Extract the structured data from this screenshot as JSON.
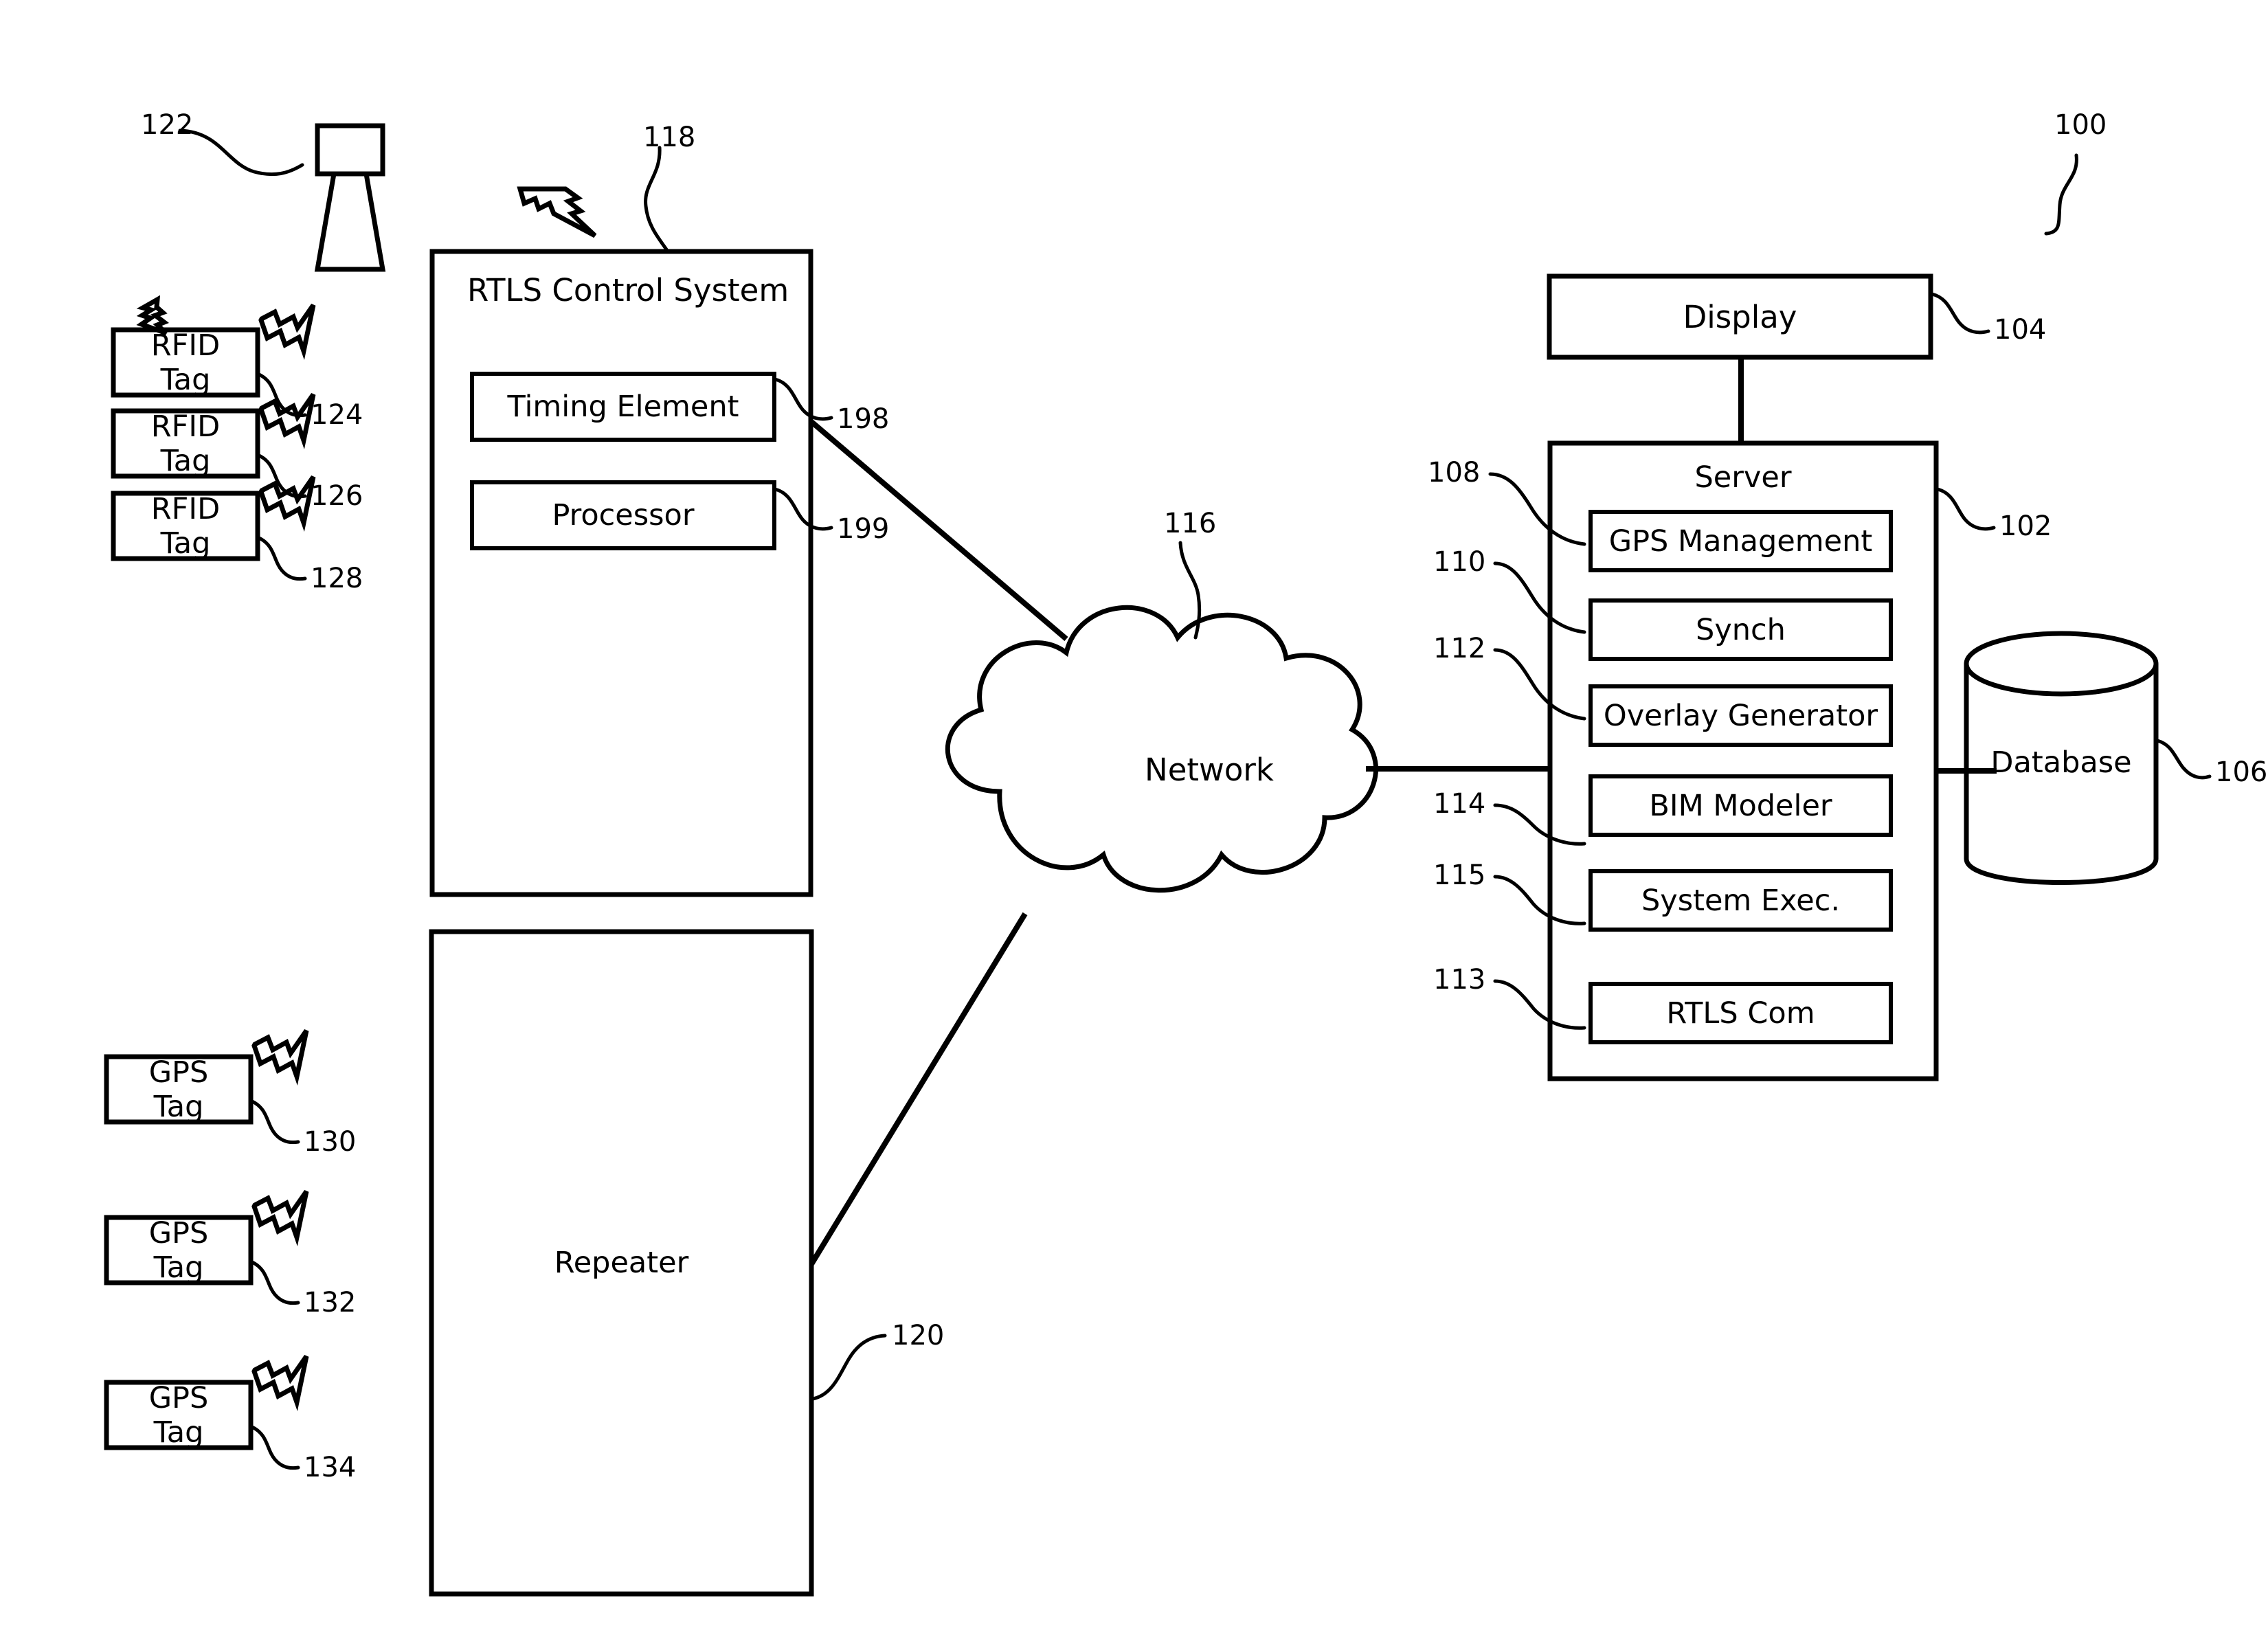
{
  "figure": {
    "system_ref": "100",
    "domain": "patent-block-diagram"
  },
  "antenna": {
    "name": "rtls-antenna",
    "ref": "122"
  },
  "rfid_tags": [
    {
      "line1": "RFID",
      "line2": "Tag",
      "ref": "124"
    },
    {
      "line1": "RFID",
      "line2": "Tag",
      "ref": "126"
    },
    {
      "line1": "RFID",
      "line2": "Tag",
      "ref": "128"
    }
  ],
  "gps_tags": [
    {
      "line1": "GPS",
      "line2": "Tag",
      "ref": "130"
    },
    {
      "line1": "GPS",
      "line2": "Tag",
      "ref": "132"
    },
    {
      "line1": "GPS",
      "line2": "Tag",
      "ref": "134"
    }
  ],
  "rtls_control_system": {
    "title": "RTLS Control System",
    "ref": "118",
    "modules": [
      {
        "label": "Timing Element",
        "ref": "198"
      },
      {
        "label": "Processor",
        "ref": "199"
      }
    ]
  },
  "repeater": {
    "label": "Repeater",
    "ref": "120"
  },
  "network": {
    "label": "Network",
    "ref": "116"
  },
  "display": {
    "label": "Display",
    "ref": "104"
  },
  "server": {
    "title": "Server",
    "ref": "102",
    "modules": [
      {
        "label": "GPS Management",
        "ref": "108"
      },
      {
        "label": "Synch",
        "ref": "110"
      },
      {
        "label": "Overlay Generator",
        "ref": "112"
      },
      {
        "label": "BIM Modeler",
        "ref": "114"
      },
      {
        "label": "System Exec.",
        "ref": "115"
      },
      {
        "label": "RTLS Com",
        "ref": "113"
      }
    ]
  },
  "database": {
    "label": "Database",
    "ref": "106"
  },
  "colors": {
    "ink": "#000000",
    "paper": "#ffffff"
  }
}
